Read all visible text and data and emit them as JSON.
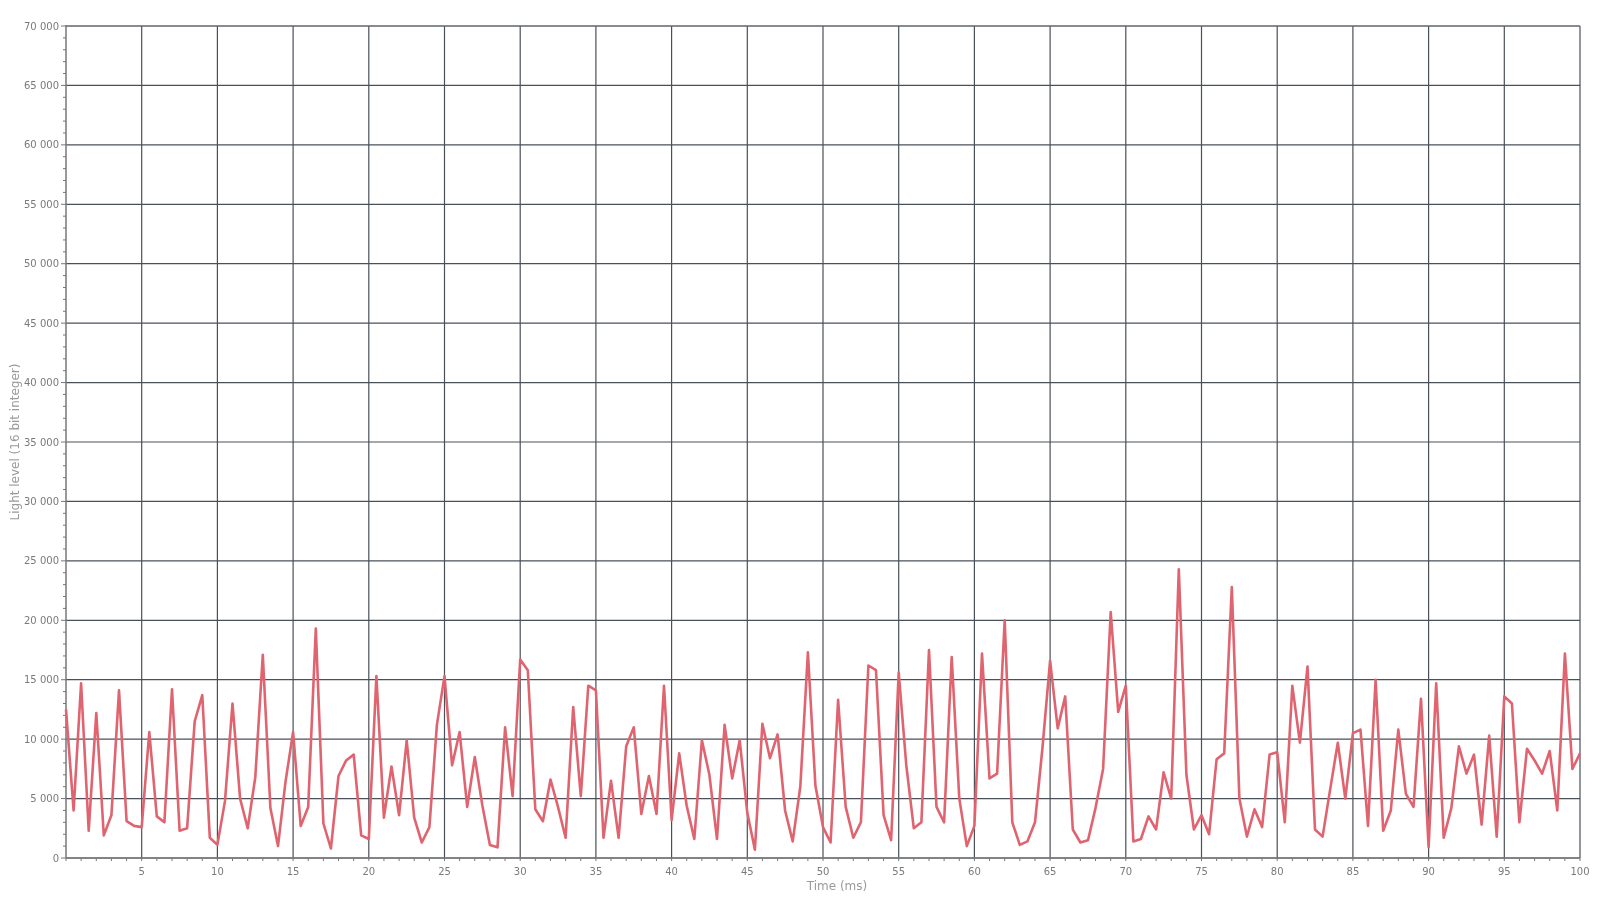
{
  "chart_data": {
    "type": "line",
    "grid": true,
    "xlabel": "Time (ms)",
    "ylabel": "Light level (16 bit integer)",
    "xlim": [
      0,
      100
    ],
    "ylim": [
      0,
      70000
    ],
    "xticks": [
      5,
      10,
      15,
      20,
      25,
      30,
      35,
      40,
      45,
      50,
      55,
      60,
      65,
      70,
      75,
      80,
      85,
      90,
      95,
      100
    ],
    "yticks": [
      {
        "value": 0,
        "label": "0"
      },
      {
        "value": 5000,
        "label": "5 000"
      },
      {
        "value": 10000,
        "label": "10 000"
      },
      {
        "value": 15000,
        "label": "15 000"
      },
      {
        "value": 20000,
        "label": "20 000"
      },
      {
        "value": 25000,
        "label": "25 000"
      },
      {
        "value": 30000,
        "label": "30 000"
      },
      {
        "value": 35000,
        "label": "35 000"
      },
      {
        "value": 40000,
        "label": "40 000"
      },
      {
        "value": 45000,
        "label": "45 000"
      },
      {
        "value": 50000,
        "label": "50 000"
      },
      {
        "value": 55000,
        "label": "55 000"
      },
      {
        "value": 60000,
        "label": "60 000"
      },
      {
        "value": 65000,
        "label": "65 000"
      },
      {
        "value": 70000,
        "label": "70 000"
      }
    ],
    "x": [
      0,
      0.5,
      1,
      1.5,
      2,
      2.5,
      3,
      3.5,
      4,
      4.5,
      5,
      5.5,
      6,
      6.5,
      7,
      7.5,
      8,
      8.5,
      9,
      9.5,
      10,
      10.5,
      11,
      11.5,
      12,
      12.5,
      13,
      13.5,
      14,
      14.5,
      15,
      15.5,
      16,
      16.5,
      17,
      17.5,
      18,
      18.5,
      19,
      19.5,
      20,
      20.5,
      21,
      21.5,
      22,
      22.5,
      23,
      23.5,
      24,
      24.5,
      25,
      25.5,
      26,
      26.5,
      27,
      27.5,
      28,
      28.5,
      29,
      29.5,
      30,
      30.5,
      31,
      31.5,
      32,
      32.5,
      33,
      33.5,
      34,
      34.5,
      35,
      35.5,
      36,
      36.5,
      37,
      37.5,
      38,
      38.5,
      39,
      39.5,
      40,
      40.5,
      41,
      41.5,
      42,
      42.5,
      43,
      43.5,
      44,
      44.5,
      45,
      45.5,
      46,
      46.5,
      47,
      47.5,
      48,
      48.5,
      49,
      49.5,
      50,
      50.5,
      51,
      51.5,
      52,
      52.5,
      53,
      53.5,
      54,
      54.5,
      55,
      55.5,
      56,
      56.5,
      57,
      57.5,
      58,
      58.5,
      59,
      59.5,
      60,
      60.5,
      61,
      61.5,
      62,
      62.5,
      63,
      63.5,
      64,
      64.5,
      65,
      65.5,
      66,
      66.5,
      67,
      67.5,
      68,
      68.5,
      69,
      69.5,
      70,
      70.5,
      71,
      71.5,
      72,
      72.5,
      73,
      73.5,
      74,
      74.5,
      75,
      75.5,
      76,
      76.5,
      77,
      77.5,
      78,
      78.5,
      79,
      79.5,
      80,
      80.5,
      81,
      81.5,
      82,
      82.5,
      83,
      83.5,
      84,
      84.5,
      85,
      85.5,
      86,
      86.5,
      87,
      87.5,
      88,
      88.5,
      89,
      89.5,
      90,
      90.5,
      91,
      91.5,
      92,
      92.5,
      93,
      93.5,
      94,
      94.5,
      95,
      95.5,
      96,
      96.5,
      97,
      97.5,
      98,
      98.5,
      99,
      99.5,
      100
    ],
    "series": [
      {
        "color": "#e06470",
        "values": [
          12500,
          4000,
          14700,
          2300,
          12200,
          1900,
          3600,
          14100,
          3100,
          2700,
          2600,
          10600,
          3500,
          3000,
          14200,
          2300,
          2500,
          11500,
          13700,
          1700,
          1100,
          4800,
          13000,
          5000,
          2500,
          6800,
          17100,
          4200,
          1000,
          6400,
          10600,
          2700,
          4300,
          19300,
          2900,
          800,
          6900,
          8200,
          8700,
          1900,
          1600,
          15300,
          3400,
          7700,
          3600,
          9900,
          3400,
          1300,
          2600,
          11200,
          15300,
          7800,
          10600,
          4300,
          8500,
          4400,
          1100,
          900,
          11000,
          5200,
          16700,
          15800,
          4100,
          3100,
          6600,
          4300,
          1700,
          12700,
          5200,
          14500,
          14100,
          1700,
          6500,
          1700,
          9400,
          11000,
          3700,
          6900,
          3700,
          14500,
          3200,
          8800,
          4400,
          1600,
          9900,
          7000,
          1600,
          11200,
          6700,
          9900,
          3800,
          700,
          11300,
          8400,
          10400,
          4000,
          1400,
          6000,
          17300,
          6100,
          2600,
          1300,
          13300,
          4300,
          1700,
          3000,
          16200,
          15800,
          3600,
          1500,
          15600,
          7800,
          2500,
          3000,
          17500,
          4300,
          3000,
          16900,
          5000,
          1000,
          2700,
          17200,
          6700,
          7100,
          20000,
          3000,
          1100,
          1400,
          3000,
          9300,
          16600,
          10900,
          13600,
          2400,
          1300,
          1500,
          4200,
          7500,
          20700,
          12300,
          14500,
          1400,
          1600,
          3500,
          2400,
          7200,
          5000,
          24300,
          7000,
          2400,
          3600,
          2000,
          8300,
          8800,
          22800,
          5000,
          1800,
          4100,
          2600,
          8700,
          8900,
          3000,
          14500,
          9700,
          16100,
          2400,
          1800,
          5800,
          9700,
          5000,
          10500,
          10800,
          2700,
          15000,
          2300,
          4000,
          10800,
          5400,
          4300,
          13400,
          900,
          14700,
          1700,
          4200,
          9400,
          7100,
          8700,
          2800,
          10300,
          1800,
          13600,
          13000,
          3000,
          9200,
          8200,
          7100,
          9000,
          4000,
          17200,
          7500,
          8800
        ]
      }
    ]
  }
}
